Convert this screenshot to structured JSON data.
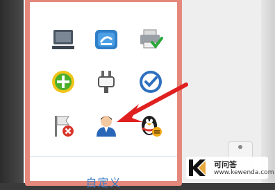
{
  "tray_popup": {
    "icons": [
      {
        "name": "display-icon"
      },
      {
        "name": "network-drive-icon"
      },
      {
        "name": "printer-check-icon"
      },
      {
        "name": "security-plus-icon"
      },
      {
        "name": "plug-icon"
      },
      {
        "name": "check-circle-icon"
      },
      {
        "name": "flag-error-icon"
      },
      {
        "name": "user-account-icon"
      },
      {
        "name": "qq-penguin-icon"
      }
    ],
    "customize_label": "自定义"
  },
  "annotation": {
    "arrow_color": "#e02020",
    "points_to": "user-account-icon"
  },
  "watermark": {
    "title": "可问答",
    "url": "www.kewenda.com"
  },
  "colors": {
    "popup_border": "#e5887c",
    "customize_link": "#3a7ec4"
  }
}
